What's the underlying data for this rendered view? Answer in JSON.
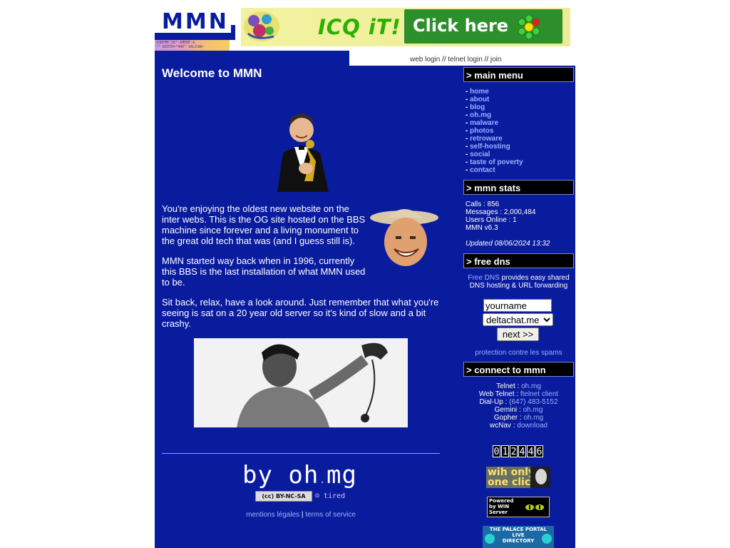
{
  "header": {
    "logo_text": "MMN",
    "logo_strip_text": "VORFMK\"20\"·AMENF·A\n\"\" WIDTH=\"400\" VALIGN=",
    "icq_text": "ICQ iT!",
    "icq_click_label": "Click here"
  },
  "login_links": {
    "web_login": "web login",
    "sep1": " // ",
    "telnet_login": "telnet login",
    "sep2": " // ",
    "join": "join"
  },
  "main": {
    "title": "Welcome to MMN",
    "para1": "You're enjoying the oldest new website on the inter webs. This is the OG site hosted on the BBS machine since forever and a living monument to the great old tech that was (and I guess still is).",
    "para2": "MMN started way back when in 1996, currently this BBS is the last installation of what MMN used to be.",
    "para3": "Sit back, relax, have a look around. Just remember that what you're seeing is sat on a 20 year old server so it's kind of slow and a bit crashy.",
    "signature_by": "by oh",
    "signature_dot": ".",
    "signature_mg": "mg",
    "cc_badge": "(cc) BY-NC-SA",
    "tired_badge": "tired",
    "mentions_legales": "mentions légales",
    "legal_sep": " | ",
    "terms": "terms of service"
  },
  "sidebar": {
    "menu_title": "> main menu",
    "menu_items": [
      "home",
      "about",
      "blog",
      "oh.mg",
      "malware",
      "photos",
      "retroware",
      "self-hosting",
      "social",
      "taste of poverty",
      "contact"
    ],
    "menu_bullet": "- ",
    "stats_title": "> mmn stats",
    "stats": {
      "calls": "Calls : 856",
      "messages": "Messages : 2,000,484",
      "users_online": "Users Online : 1",
      "version": "MMN v6.3",
      "updated": "Updated 08/06/2024 13:32"
    },
    "dns_title": "> free dns",
    "dns_link": "Free DNS",
    "dns_text": " provides easy shared DNS hosting & URL forwarding",
    "dns_name_value": "yourname",
    "dns_domain_value": "deltachat.me",
    "dns_next": "next >>",
    "dns_spam": "protection contre les spams",
    "connect_title": "> connect to mmn",
    "connect": [
      {
        "label": "Telnet : ",
        "value": "oh.mg"
      },
      {
        "label": "Web Telnet : ",
        "value": "ftelnet client"
      },
      {
        "label": "Dial-Up : ",
        "value": "(647) 483-5152"
      },
      {
        "label": "Gemini : ",
        "value": "oh.mg"
      },
      {
        "label": "Gopher : ",
        "value": "oh.mg"
      },
      {
        "label": "wcNav : ",
        "value": "download"
      }
    ],
    "counter_digits": [
      "0",
      "1",
      "2",
      "4",
      "4",
      "6"
    ],
    "one_click_text": "wih only\none click",
    "win_server_text": "Powered\nby WIN\nServer",
    "palace_text": "THE PALACE PORTAL\nLIVE\nDIRECTORY"
  },
  "colors": {
    "main_blue": "#0a1c9e",
    "link": "#9ab0ff",
    "panel_head": "#000000"
  }
}
